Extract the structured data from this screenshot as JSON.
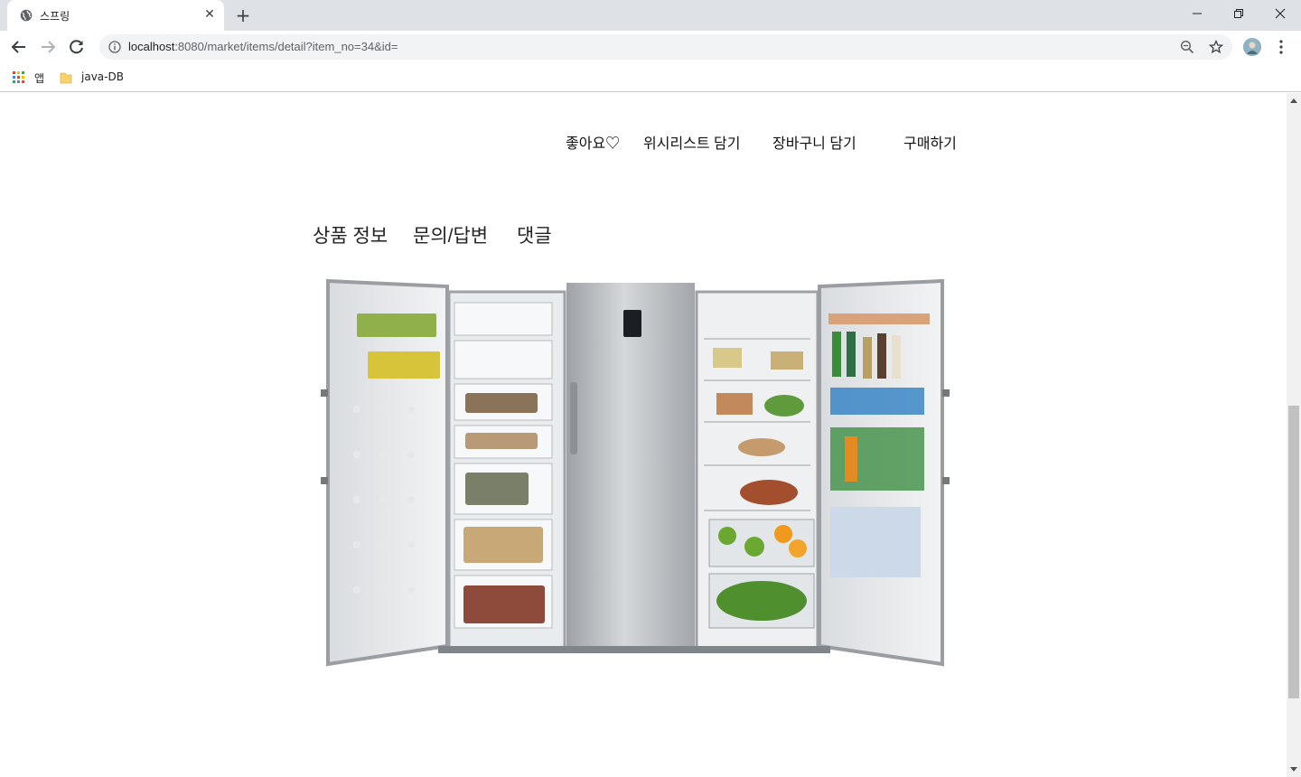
{
  "browser": {
    "tab_title": "스프링",
    "tab_close": "✕",
    "new_tab": "+",
    "url_host": "localhost",
    "url_rest": ":8080/market/items/detail?item_no=34&id=",
    "bookmarks": [
      {
        "label": "앱",
        "icon": "apps-grid-icon"
      },
      {
        "label": "java-DB",
        "icon": "folder-icon"
      }
    ]
  },
  "page": {
    "actions": {
      "like": "좋아요♡",
      "wishlist": "위시리스트 담기",
      "cart": "장바구니 담기",
      "buy": "구매하기"
    },
    "tabs": {
      "info": "상품 정보",
      "qna": "문의/답변",
      "comments": "댓글"
    },
    "image": {
      "subject": "side-by-side refrigerator with doors open",
      "colors": {
        "body": "#b8bbbe",
        "door_inner": "#f3f4f5",
        "steel": "#a9adb0"
      }
    }
  }
}
